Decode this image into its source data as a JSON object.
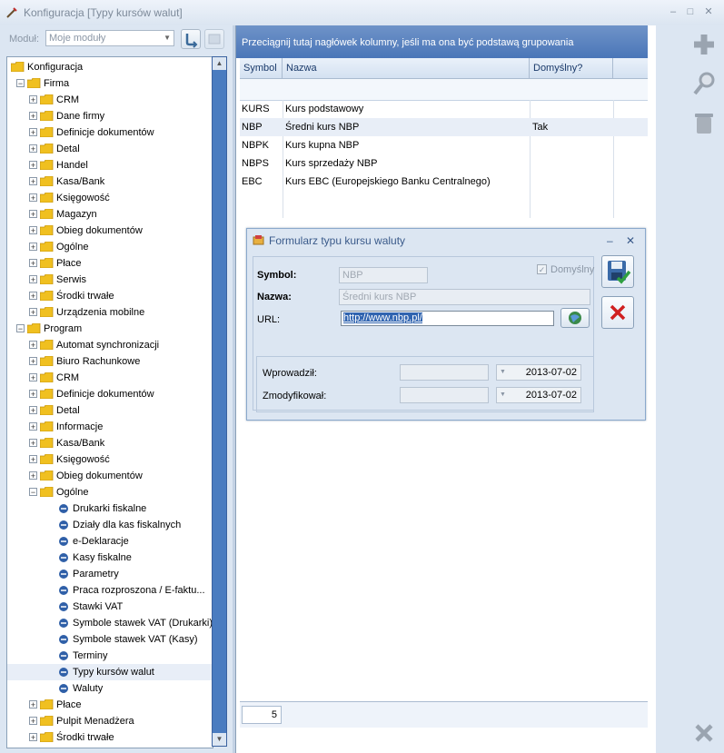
{
  "window": {
    "title": "Konfiguracja [Typy kursów walut]",
    "minimize_glyph": "–",
    "maximize_glyph": "□",
    "close_glyph": "✕"
  },
  "module_bar": {
    "label": "Moduł:",
    "selected": "Moje moduły"
  },
  "tree": [
    {
      "label": "Konfiguracja",
      "level": 0,
      "kind": "folder",
      "expander": ""
    },
    {
      "label": "Firma",
      "level": 1,
      "kind": "folder",
      "expander": "−"
    },
    {
      "label": "CRM",
      "level": 2,
      "kind": "folder",
      "expander": "+"
    },
    {
      "label": "Dane firmy",
      "level": 2,
      "kind": "folder",
      "expander": "+"
    },
    {
      "label": "Definicje dokumentów",
      "level": 2,
      "kind": "folder",
      "expander": "+"
    },
    {
      "label": "Detal",
      "level": 2,
      "kind": "folder",
      "expander": "+"
    },
    {
      "label": "Handel",
      "level": 2,
      "kind": "folder",
      "expander": "+"
    },
    {
      "label": "Kasa/Bank",
      "level": 2,
      "kind": "folder",
      "expander": "+"
    },
    {
      "label": "Księgowość",
      "level": 2,
      "kind": "folder",
      "expander": "+"
    },
    {
      "label": "Magazyn",
      "level": 2,
      "kind": "folder",
      "expander": "+"
    },
    {
      "label": "Obieg dokumentów",
      "level": 2,
      "kind": "folder",
      "expander": "+"
    },
    {
      "label": "Ogólne",
      "level": 2,
      "kind": "folder",
      "expander": "+"
    },
    {
      "label": "Płace",
      "level": 2,
      "kind": "folder",
      "expander": "+"
    },
    {
      "label": "Serwis",
      "level": 2,
      "kind": "folder",
      "expander": "+"
    },
    {
      "label": "Środki trwałe",
      "level": 2,
      "kind": "folder",
      "expander": "+"
    },
    {
      "label": "Urządzenia mobilne",
      "level": 2,
      "kind": "folder",
      "expander": "+"
    },
    {
      "label": "Program",
      "level": 1,
      "kind": "folder",
      "expander": "−"
    },
    {
      "label": "Automat synchronizacji",
      "level": 2,
      "kind": "folder",
      "expander": "+"
    },
    {
      "label": "Biuro Rachunkowe",
      "level": 2,
      "kind": "folder",
      "expander": "+"
    },
    {
      "label": "CRM",
      "level": 2,
      "kind": "folder",
      "expander": "+"
    },
    {
      "label": "Definicje dokumentów",
      "level": 2,
      "kind": "folder",
      "expander": "+"
    },
    {
      "label": "Detal",
      "level": 2,
      "kind": "folder",
      "expander": "+"
    },
    {
      "label": "Informacje",
      "level": 2,
      "kind": "folder",
      "expander": "+"
    },
    {
      "label": "Kasa/Bank",
      "level": 2,
      "kind": "folder",
      "expander": "+"
    },
    {
      "label": "Księgowość",
      "level": 2,
      "kind": "folder",
      "expander": "+"
    },
    {
      "label": "Obieg dokumentów",
      "level": 2,
      "kind": "folder",
      "expander": "+"
    },
    {
      "label": "Ogólne",
      "level": 2,
      "kind": "folder",
      "expander": "−"
    },
    {
      "label": "Drukarki fiskalne",
      "level": 3,
      "kind": "leaf",
      "expander": ""
    },
    {
      "label": "Działy dla kas fiskalnych",
      "level": 3,
      "kind": "leaf",
      "expander": ""
    },
    {
      "label": "e-Deklaracje",
      "level": 3,
      "kind": "leaf",
      "expander": ""
    },
    {
      "label": "Kasy fiskalne",
      "level": 3,
      "kind": "leaf",
      "expander": ""
    },
    {
      "label": "Parametry",
      "level": 3,
      "kind": "leaf",
      "expander": ""
    },
    {
      "label": "Praca rozproszona / E-faktu...",
      "level": 3,
      "kind": "leaf",
      "expander": ""
    },
    {
      "label": "Stawki VAT",
      "level": 3,
      "kind": "leaf",
      "expander": ""
    },
    {
      "label": "Symbole stawek VAT (Drukarki)",
      "level": 3,
      "kind": "leaf",
      "expander": ""
    },
    {
      "label": "Symbole stawek VAT (Kasy)",
      "level": 3,
      "kind": "leaf",
      "expander": ""
    },
    {
      "label": "Terminy",
      "level": 3,
      "kind": "leaf",
      "expander": ""
    },
    {
      "label": "Typy kursów walut",
      "level": 3,
      "kind": "leaf",
      "expander": "",
      "selected": true
    },
    {
      "label": "Waluty",
      "level": 3,
      "kind": "leaf",
      "expander": ""
    },
    {
      "label": "Płace",
      "level": 2,
      "kind": "folder",
      "expander": "+"
    },
    {
      "label": "Pulpit Menadżera",
      "level": 2,
      "kind": "folder",
      "expander": "+"
    },
    {
      "label": "Środki trwałe",
      "level": 2,
      "kind": "folder",
      "expander": "+"
    }
  ],
  "grid": {
    "group_hint": "Przeciągnij tutaj nagłówek kolumny, jeśli ma ona być podstawą grupowania",
    "columns": [
      "Symbol",
      "Nazwa",
      "Domyślny?"
    ],
    "rows": [
      {
        "symbol": "KURS",
        "nazwa": "Kurs podstawowy",
        "domyslny": ""
      },
      {
        "symbol": "NBP",
        "nazwa": "Średni kurs NBP",
        "domyslny": "Tak"
      },
      {
        "symbol": "NBPK",
        "nazwa": "Kurs kupna NBP",
        "domyslny": ""
      },
      {
        "symbol": "NBPS",
        "nazwa": "Kurs sprzedaży NBP",
        "domyslny": ""
      },
      {
        "symbol": "EBC",
        "nazwa": "Kurs EBC (Europejskiego Banku Centralnego)",
        "domyslny": ""
      }
    ],
    "count": "5"
  },
  "dialog": {
    "title": "Formularz typu kursu waluty",
    "minimize_glyph": "–",
    "close_glyph": "✕",
    "symbol_label": "Symbol:",
    "symbol_value": "NBP",
    "domyslny_label": "Domyślny",
    "domyslny_mark": "✓",
    "nazwa_label": "Nazwa:",
    "nazwa_value": "Średni kurs NBP",
    "url_label": "URL:",
    "url_value": "http://www.nbp.pl/",
    "wprowadzil_label": "Wprowadził:",
    "wprowadzil_date": "2013-07-02",
    "zmodyfikowal_label": "Zmodyfikował:",
    "zmodyfikowal_date": "2013-07-02"
  },
  "colors": {
    "accent": "#4a76b8",
    "folder": "#f0c020",
    "selected_row": "#e8eef7"
  }
}
